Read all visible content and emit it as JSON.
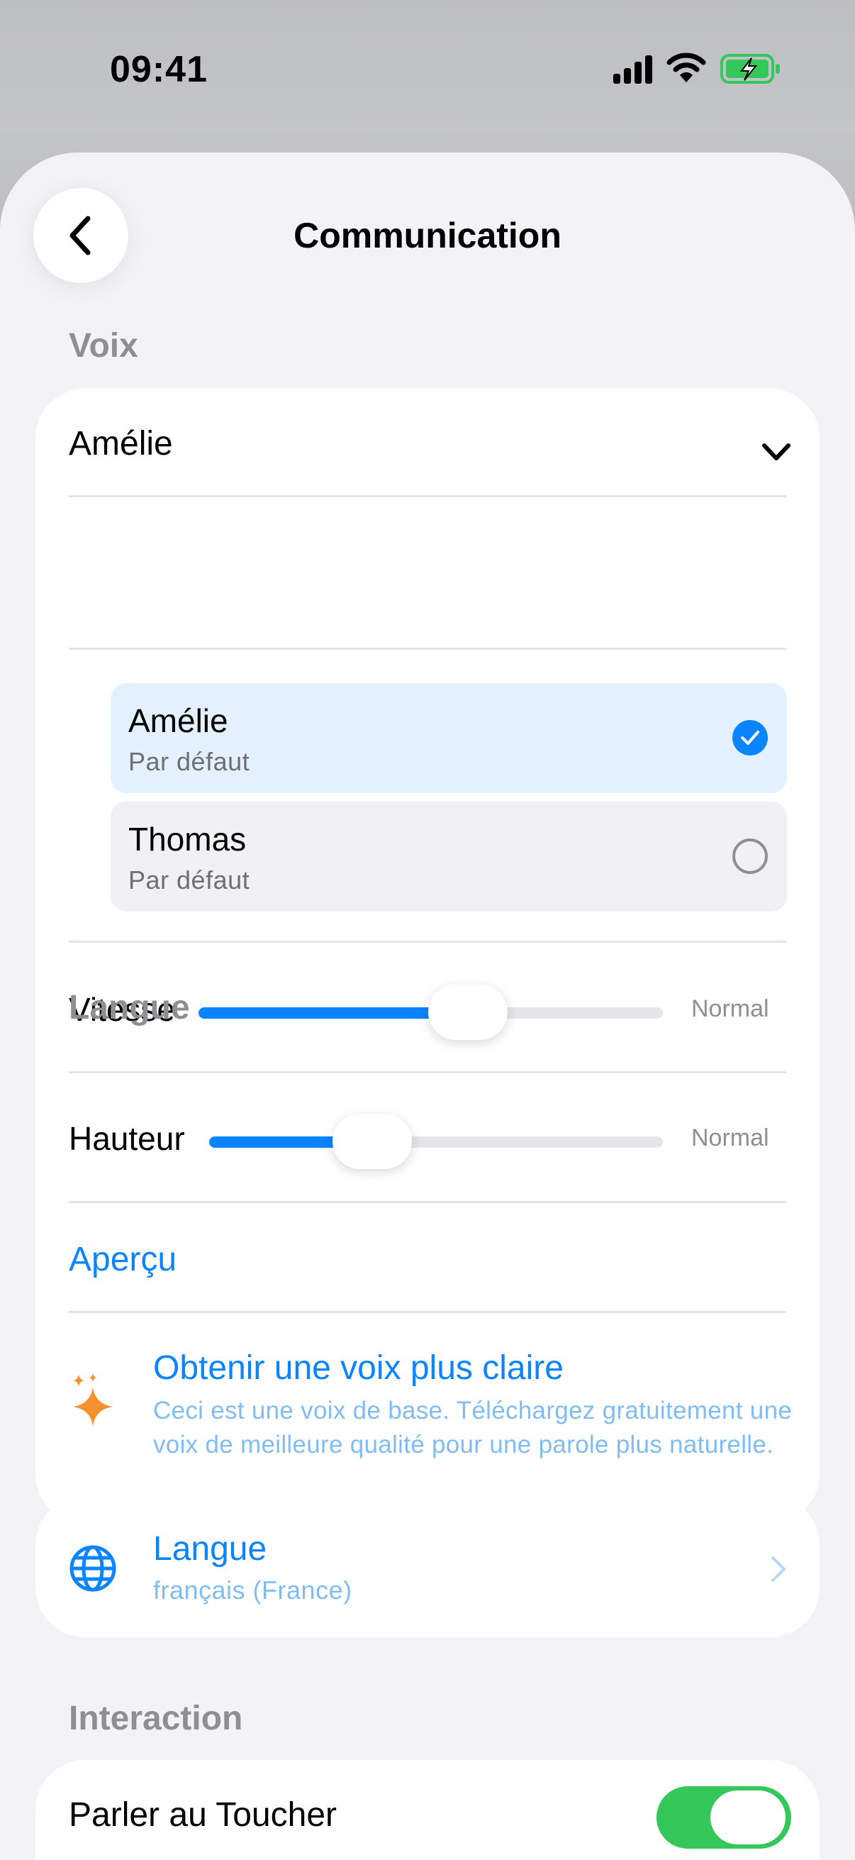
{
  "status_bar": {
    "time": "09:41"
  },
  "nav": {
    "title": "Communication"
  },
  "voice_section": {
    "header": "Voix",
    "selected_voice": "Amélie",
    "options": [
      {
        "name": "Amélie",
        "subtitle": "Par défaut",
        "selected": true
      },
      {
        "name": "Thomas",
        "subtitle": "Par défaut",
        "selected": false
      }
    ],
    "speed": {
      "label": "Vitesse",
      "value_text": "Normal",
      "level": 0.58
    },
    "pitch": {
      "label": "Hauteur",
      "value_text": "Normal",
      "level": 0.36
    },
    "preview_label": "Aperçu",
    "promo": {
      "title": "Obtenir une voix plus claire",
      "text": "Ceci est une voix de base. Téléchargez gratuitement une voix de meilleure qualité pour une parole plus naturelle."
    }
  },
  "language_section": {
    "header": "Langue",
    "row_title": "Langue",
    "row_value": "français (France)"
  },
  "interaction_section": {
    "header": "Interaction",
    "speak_on_touch": {
      "label": "Parler au Toucher",
      "enabled": true
    }
  },
  "colors": {
    "accent": "#0a84ff",
    "toggle_on": "#34c759",
    "promo_icon": "#f5922f"
  },
  "icons": [
    "back-chevron-icon",
    "chevron-down-icon",
    "checkmark-icon",
    "sparkles-icon",
    "globe-icon",
    "chevron-right-icon",
    "signal-icon",
    "wifi-icon",
    "battery-icon"
  ]
}
